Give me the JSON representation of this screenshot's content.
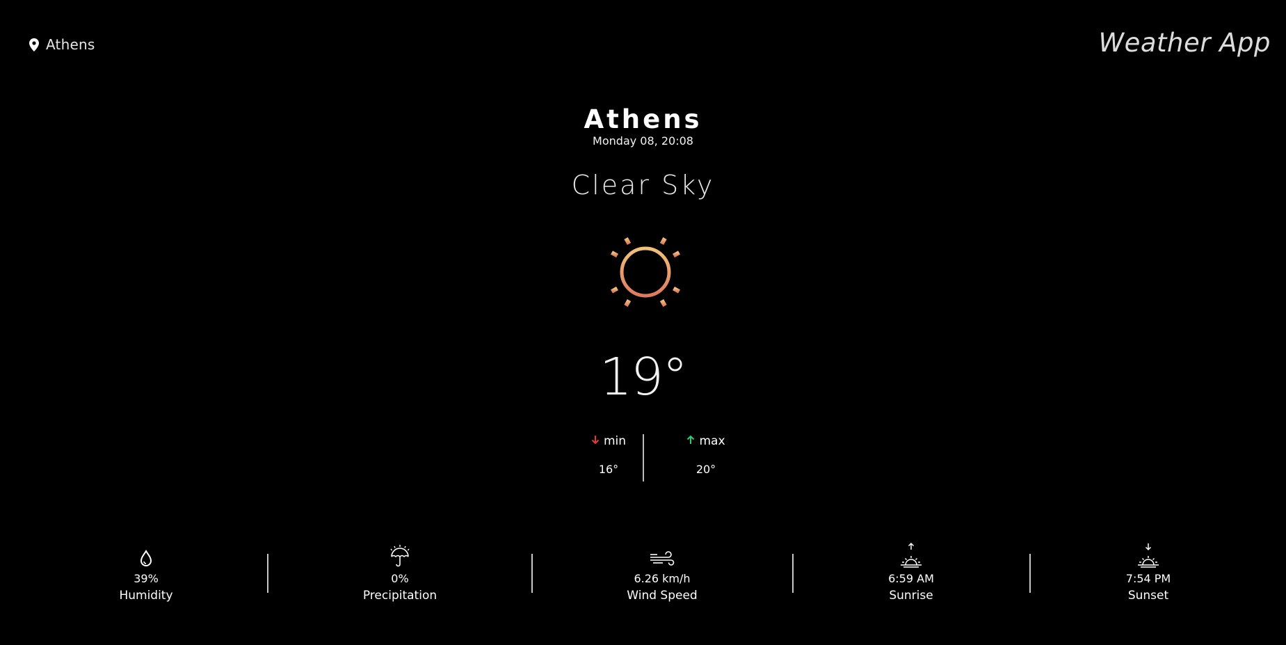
{
  "header": {
    "location": "Athens",
    "brand": "Weather App"
  },
  "current": {
    "city": "Athens",
    "datetime": "Monday 08, 20:08",
    "condition": "Clear Sky",
    "icon": "sun-icon",
    "temperature": "19°",
    "min_label": "min",
    "min_value": "16°",
    "max_label": "max",
    "max_value": "20°"
  },
  "stats": {
    "humidity": {
      "value": "39%",
      "label": "Humidity",
      "icon": "droplet-icon"
    },
    "precipitation": {
      "value": "0%",
      "label": "Precipitation",
      "icon": "umbrella-icon"
    },
    "wind": {
      "value": "6.26 km/h",
      "label": "Wind Speed",
      "icon": "wind-icon"
    },
    "sunrise": {
      "value": "6:59 AM",
      "label": "Sunrise",
      "icon": "sunrise-icon"
    },
    "sunset": {
      "value": "7:54 PM",
      "label": "Sunset",
      "icon": "sunset-icon"
    }
  },
  "colors": {
    "background": "#000000",
    "sun_gradient_top": "#f0c27b",
    "sun_gradient_bottom": "#e07a5f",
    "min_arrow": "#e53935",
    "max_arrow": "#2ecc71"
  }
}
